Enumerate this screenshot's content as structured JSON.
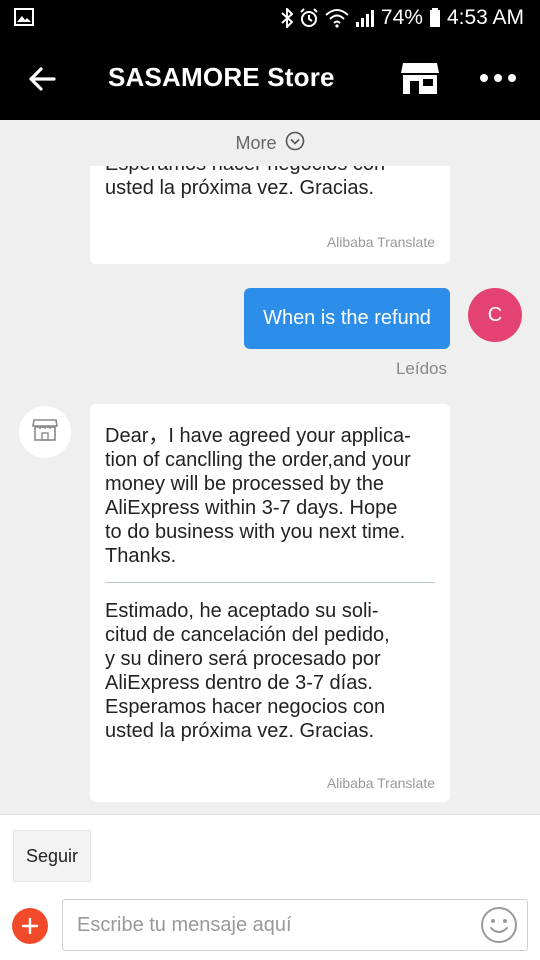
{
  "status_bar": {
    "battery": "74%",
    "time": "4:53 AM",
    "icons": [
      "image-icon",
      "bluetooth-icon",
      "alarm-icon",
      "wifi-icon",
      "signal-icon",
      "battery-icon"
    ]
  },
  "app_bar": {
    "title": "SASAMORE Store",
    "icons": [
      "back-arrow-icon",
      "store-icon",
      "more-dots-icon"
    ]
  },
  "more_bar": {
    "label": "More",
    "icon": "chevron-down-circle-icon"
  },
  "messages": [
    {
      "direction": "incoming",
      "text": "Esperamos hacer negocios con\nusted la próxima vez. Gracias.",
      "translate_credit": "Alibaba Translate"
    },
    {
      "direction": "outgoing",
      "text": "When is the refund",
      "avatar_letter": "C",
      "status": "Leídos"
    },
    {
      "direction": "incoming",
      "text": "Dear，I have agreed your applica-\ntion of canclling the order,and your\nmoney will be processed by the\nAliExpress within 3-7 days. Hope\nto do business with you next time.\nThanks.",
      "translation": "Estimado, he aceptado su soli-\ncitud de cancelación del pedido,\ny su dinero será procesado por\nAliExpress dentro de 3-7 días.\nEsperamos hacer negocios con\nusted la próxima vez. Gracias.",
      "translate_credit": "Alibaba Translate"
    }
  ],
  "bottom": {
    "follow_label": "Seguir",
    "input_placeholder": "Escribe tu mensaje aquí",
    "input_value": ""
  },
  "colors": {
    "header_bg": "#000000",
    "outgoing_bubble": "#2d8ee9",
    "user_avatar": "#e44272",
    "add_button": "#f04a2a"
  }
}
